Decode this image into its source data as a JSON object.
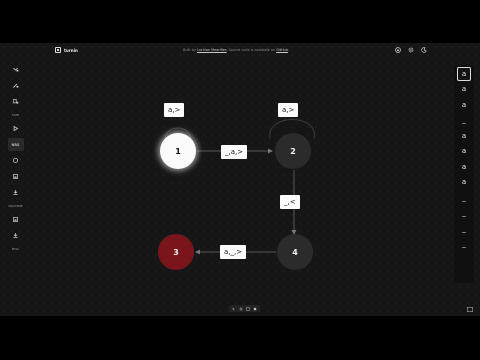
{
  "header": {
    "app_title": "turnin",
    "credit_prefix": "Built by ",
    "credit_author": "Lochlan Mearifies",
    "credit_middle": ". Source code is available on ",
    "credit_repo": "GitHub",
    "credit_suffix": ".",
    "icons": [
      "github-icon",
      "settings-icon",
      "theme-icon"
    ]
  },
  "left_toolbar": {
    "sections": [
      "TAPE",
      "ROBOTS",
      "MACHINE",
      "MISC"
    ],
    "misc_label": "MISC",
    "tape_label": "TAPE",
    "machine_label": "MACHINE",
    "active_tool_label": "NRS"
  },
  "tape": {
    "cells": [
      "a",
      "a",
      "a",
      "_",
      "a",
      "a",
      "a",
      "a",
      "_",
      "_",
      "_",
      "_"
    ],
    "head_index": 0
  },
  "graph": {
    "states": [
      {
        "id": "1",
        "label": "1",
        "status": "current"
      },
      {
        "id": "2",
        "label": "2",
        "status": "normal"
      },
      {
        "id": "3",
        "label": "3",
        "status": "reject"
      },
      {
        "id": "4",
        "label": "4",
        "status": "normal"
      }
    ],
    "transitions": [
      {
        "label": "a,>"
      },
      {
        "label": "a,>"
      },
      {
        "label": "_,a,>"
      },
      {
        "label": "_,<"
      },
      {
        "label": "a,_,>"
      }
    ]
  },
  "dock": {
    "buttons": [
      "pointer-icon",
      "pan-icon",
      "zoom-icon",
      "fit-icon"
    ]
  },
  "colors": {
    "background": "#161616",
    "current_state": "#fafafa",
    "normal_state": "#2b2b2b",
    "reject_state": "#7a161b"
  }
}
